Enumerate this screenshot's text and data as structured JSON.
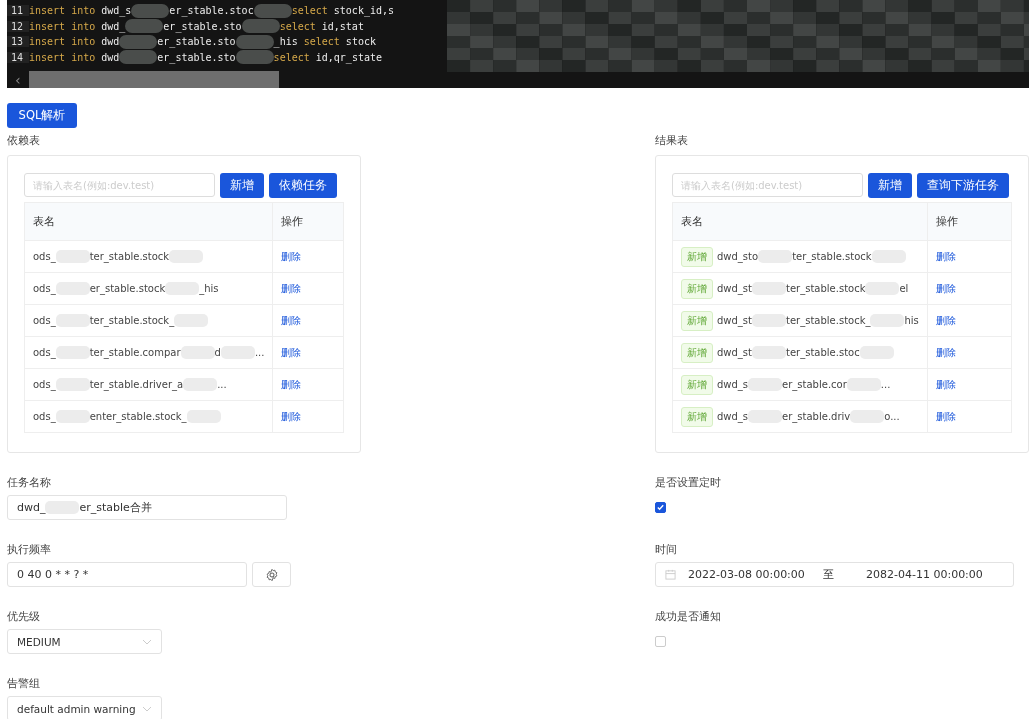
{
  "editor": {
    "lines": [
      {
        "number": "11",
        "parts": [
          {
            "kind": "keyword",
            "text": "insert into"
          },
          {
            "kind": "plain",
            "text": " dwd_s"
          },
          {
            "kind": "blur"
          },
          {
            "kind": "plain",
            "text": "er_stable.stoc"
          },
          {
            "kind": "blur"
          },
          {
            "kind": "keyword",
            "text": "select"
          },
          {
            "kind": "plain",
            "text": " stock_id,s"
          }
        ]
      },
      {
        "number": "12",
        "parts": [
          {
            "kind": "keyword",
            "text": "insert into"
          },
          {
            "kind": "plain",
            "text": " dwd_"
          },
          {
            "kind": "blur"
          },
          {
            "kind": "plain",
            "text": "er_stable.sto"
          },
          {
            "kind": "blur"
          },
          {
            "kind": "keyword",
            "text": "select"
          },
          {
            "kind": "plain",
            "text": " id,stat"
          }
        ]
      },
      {
        "number": "13",
        "parts": [
          {
            "kind": "keyword",
            "text": "insert into"
          },
          {
            "kind": "plain",
            "text": " dwd"
          },
          {
            "kind": "blur"
          },
          {
            "kind": "plain",
            "text": "er_stable.sto"
          },
          {
            "kind": "blur"
          },
          {
            "kind": "plain",
            "text": "_his "
          },
          {
            "kind": "keyword",
            "text": "select"
          },
          {
            "kind": "plain",
            "text": " stock"
          }
        ]
      },
      {
        "number": "14",
        "parts": [
          {
            "kind": "keyword",
            "text": "insert into"
          },
          {
            "kind": "plain",
            "text": " dwd"
          },
          {
            "kind": "blur"
          },
          {
            "kind": "plain",
            "text": "er_stable.sto"
          },
          {
            "kind": "blur"
          },
          {
            "kind": "keyword",
            "text": "select"
          },
          {
            "kind": "plain",
            "text": " id,qr_state"
          }
        ]
      }
    ],
    "scroll_arrow": "‹"
  },
  "parse_button": "SQL解析",
  "panels": [
    {
      "kind": "source",
      "title": "依赖表",
      "placeholder": "请输入表名(例如:dev.test)",
      "add_button": "新增",
      "extra_button": "依赖任务",
      "columns": [
        "表名",
        "操作"
      ],
      "rows": [
        {
          "tag": null,
          "parts": [
            "ods_",
            "ter_stable.stock"
          ],
          "blur_after": true,
          "action": "删除"
        },
        {
          "tag": null,
          "parts": [
            "ods_",
            "er_stable.stock",
            "_his"
          ],
          "action": "删除"
        },
        {
          "tag": null,
          "parts": [
            "ods_",
            "ter_stable.stock_"
          ],
          "blur_after": true,
          "action": "删除"
        },
        {
          "tag": null,
          "parts": [
            "ods_",
            "ter_stable.compar",
            "d",
            "..."
          ],
          "action": "删除"
        },
        {
          "tag": null,
          "parts": [
            "ods_",
            "ter_stable.driver_a",
            "..."
          ],
          "action": "删除"
        },
        {
          "tag": null,
          "parts": [
            "ods_",
            "enter_stable.stock_"
          ],
          "blur_after": true,
          "action": "删除"
        }
      ]
    },
    {
      "kind": "result",
      "title": "结果表",
      "placeholder": "请输入表名(例如:dev.test)",
      "add_button": "新增",
      "extra_button": "查询下游任务",
      "columns": [
        "表名",
        "操作"
      ],
      "rows": [
        {
          "tag": "新增",
          "parts": [
            "dwd_sto",
            "ter_stable.stock"
          ],
          "blur_after": true,
          "action": "删除"
        },
        {
          "tag": "新增",
          "parts": [
            "dwd_st",
            "ter_stable.stock",
            "el"
          ],
          "action": "删除"
        },
        {
          "tag": "新增",
          "parts": [
            "dwd_st",
            "ter_stable.stock_",
            "his"
          ],
          "action": "删除"
        },
        {
          "tag": "新增",
          "parts": [
            "dwd_st",
            "ter_stable.stoc"
          ],
          "blur_after": true,
          "action": "删除"
        },
        {
          "tag": "新增",
          "parts": [
            "dwd_s",
            "er_stable.cor",
            "..."
          ],
          "action": "删除"
        },
        {
          "tag": "新增",
          "parts": [
            "dwd_s",
            "er_stable.driv",
            "o..."
          ],
          "action": "删除"
        }
      ]
    }
  ],
  "form_left": [
    {
      "kind": "text",
      "label": "任务名称",
      "parts": [
        "dwd_",
        "er_stable合并"
      ]
    },
    {
      "kind": "cron",
      "label": "执行频率",
      "parts": [
        "0 40 0 * * ? *"
      ]
    },
    {
      "kind": "select",
      "label": "优先级",
      "parts": [
        "MEDIUM"
      ]
    },
    {
      "kind": "select",
      "label": "告警组",
      "parts": [
        "default admin warning"
      ]
    }
  ],
  "form_right": [
    {
      "kind": "checkbox",
      "label": "是否设置定时",
      "checked": true
    },
    {
      "kind": "range",
      "label": "时间",
      "start": "2022-03-08 00:00:00",
      "separator": "至",
      "end": "2082-04-11 00:00:00"
    },
    {
      "kind": "checkbox",
      "label": "成功是否通知",
      "checked": false
    }
  ]
}
